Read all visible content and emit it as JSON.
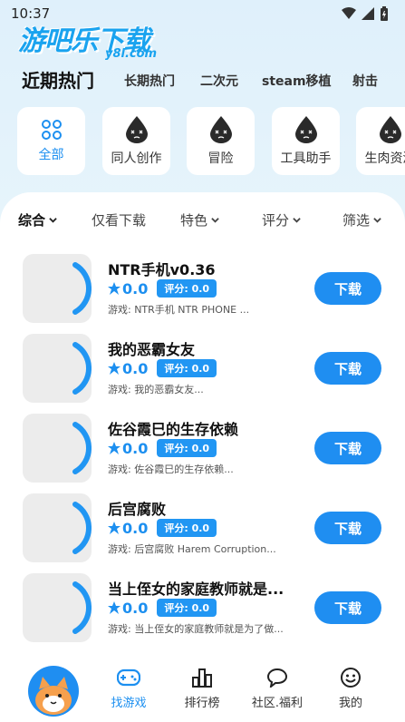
{
  "status": {
    "time": "10:37"
  },
  "logo": {
    "main": "游吧乐下载",
    "sub": "y8l.com"
  },
  "top_tabs": [
    "近期热门",
    "长期热门",
    "二次元",
    "steam移植",
    "射击"
  ],
  "categories": [
    {
      "label": "全部",
      "icon": "grid-icon"
    },
    {
      "label": "同人创作",
      "icon": "drop-face-icon"
    },
    {
      "label": "冒险",
      "icon": "drop-face-icon"
    },
    {
      "label": "工具助手",
      "icon": "drop-face-icon"
    },
    {
      "label": "生肉资源",
      "icon": "drop-face-icon"
    }
  ],
  "filters": [
    "综合",
    "仅看下载",
    "特色",
    "评分",
    "筛选"
  ],
  "games": [
    {
      "title": "NTR手机v0.36",
      "rating": "0.0",
      "score": "评分: 0.0",
      "desc": "游戏: NTR手机   NTR PHONE ...",
      "button": "下载"
    },
    {
      "title": "我的恶霸女友",
      "rating": "0.0",
      "score": "评分: 0.0",
      "desc": "游戏: 我的恶霸女友...",
      "button": "下载"
    },
    {
      "title": "佐谷霞巳的生存依赖",
      "rating": "0.0",
      "score": "评分: 0.0",
      "desc": "游戏:  佐谷霞巳的生存依赖...",
      "button": "下载"
    },
    {
      "title": "后宫腐败",
      "rating": "0.0",
      "score": "评分: 0.0",
      "desc": "游戏: 后宫腐败   Harem Corruption...",
      "button": "下载"
    },
    {
      "title": "当上侄女的家庭教师就是...",
      "rating": "0.0",
      "score": "评分: 0.0",
      "desc": "游戏: 当上侄女的家庭教师就是为了做...",
      "button": "下载"
    }
  ],
  "bottom_nav": [
    "找游戏",
    "排行榜",
    "社区.福利",
    "我的"
  ],
  "colors": {
    "accent": "#1f8ef1",
    "badge": "#2196f3",
    "bg": "#e3f2fb"
  }
}
